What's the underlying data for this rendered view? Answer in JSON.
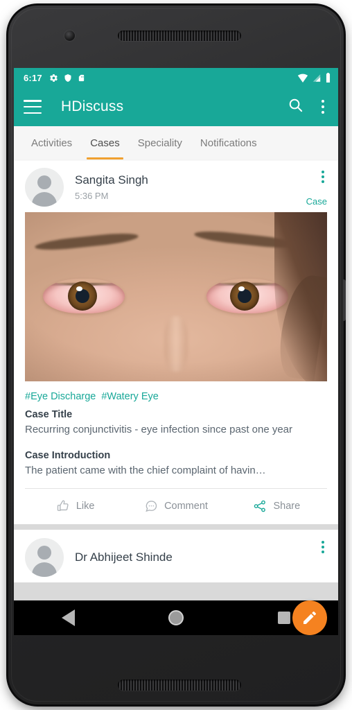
{
  "colors": {
    "teal": "#18a898",
    "accent_orange": "#f0a030",
    "fab_orange": "#f58220"
  },
  "status_bar": {
    "time": "6:17",
    "left_icons": [
      "settings-gear-icon",
      "shield-icon",
      "sd-card-icon"
    ],
    "right_icons": [
      "wifi-icon",
      "cellular-signal-icon",
      "battery-icon"
    ]
  },
  "app_bar": {
    "menu_icon": "hamburger-menu-icon",
    "title": "HDiscuss",
    "search_icon": "search-icon",
    "overflow_icon": "overflow-menu-icon"
  },
  "tabs": {
    "items": [
      {
        "label": "Activities",
        "active": false
      },
      {
        "label": "Cases",
        "active": true
      },
      {
        "label": "Speciality",
        "active": false
      },
      {
        "label": "Notifications",
        "active": false
      }
    ]
  },
  "feed": {
    "posts": [
      {
        "author": "Sangita Singh",
        "time": "5:36 PM",
        "type_label": "Case",
        "avatar": "default-user-avatar",
        "image_alt": "close-up-photo-of-red-irritated-eyes",
        "tags": [
          "#Eye Discharge",
          "#Watery Eye"
        ],
        "title_label": "Case Title",
        "title_text": "Recurring conjunctivitis - eye infection since past one year",
        "intro_label": "Case Introduction",
        "intro_text": "The patient came with the chief complaint of havin…",
        "actions": [
          {
            "label": "Like",
            "icon": "thumbs-up-icon"
          },
          {
            "label": "Comment",
            "icon": "comment-bubble-icon"
          },
          {
            "label": "Share",
            "icon": "share-icon"
          }
        ]
      },
      {
        "author": "Dr Abhijeet Shinde"
      }
    ]
  },
  "fab": {
    "icon": "pencil-edit-icon"
  },
  "nav_bar": {
    "back": "back-triangle-icon",
    "home": "home-circle-icon",
    "recents": "recents-square-icon"
  }
}
